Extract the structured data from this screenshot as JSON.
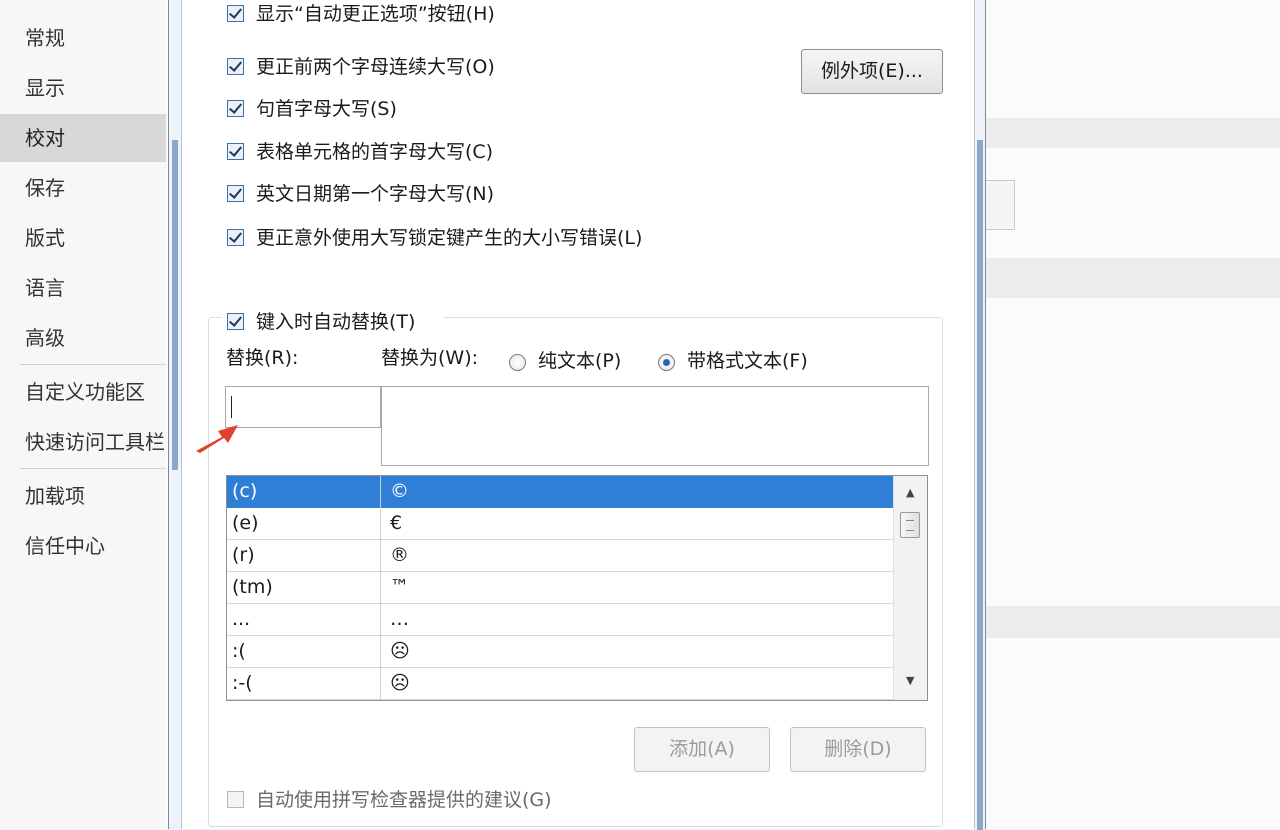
{
  "nav": {
    "items": [
      {
        "label": "常规"
      },
      {
        "label": "显示"
      },
      {
        "label": "校对",
        "selected": true
      },
      {
        "label": "保存"
      },
      {
        "label": "版式"
      },
      {
        "label": "语言"
      },
      {
        "label": "高级"
      },
      {
        "label": "自定义功能区"
      },
      {
        "label": "快速访问工具栏"
      },
      {
        "label": "加载项"
      },
      {
        "label": "信任中心"
      }
    ]
  },
  "autocorrect": {
    "show_options_button": {
      "label": "显示“自动更正选项”按钮(H)",
      "checked": true
    },
    "two_initial_caps": {
      "label": "更正前两个字母连续大写(O)",
      "checked": true
    },
    "capitalize_sentences": {
      "label": "句首字母大写(S)",
      "checked": true
    },
    "capitalize_table_cells": {
      "label": "表格单元格的首字母大写(C)",
      "checked": true
    },
    "capitalize_day_names": {
      "label": "英文日期第一个字母大写(N)",
      "checked": true
    },
    "caps_lock_correction": {
      "label": "更正意外使用大写锁定键产生的大小写错误(L)",
      "checked": true
    },
    "exceptions_button": "例外项(E)...",
    "replace_as_you_type": {
      "label": "键入时自动替换(T)",
      "checked": true
    },
    "replace_label": "替换(R):",
    "with_label": "替换为(W):",
    "plain_text_option": {
      "label": "纯文本(P)",
      "selected": false
    },
    "formatted_text_option": {
      "label": "带格式文本(F)",
      "selected": true
    },
    "replace_value": "",
    "with_value": "",
    "entries": [
      {
        "replace": "(c)",
        "with": "©"
      },
      {
        "replace": "(e)",
        "with": "€"
      },
      {
        "replace": "(r)",
        "with": "®"
      },
      {
        "replace": "(tm)",
        "with": "™"
      },
      {
        "replace": "...",
        "with": "…"
      },
      {
        "replace": ":(",
        "with": "☹"
      },
      {
        "replace": ":-(",
        "with": "☹"
      }
    ],
    "selected_entry": 0,
    "add_button": "添加(A)",
    "delete_button": "删除(D)",
    "spelling_suggestions": {
      "label": "自动使用拼写检查器提供的建议(G)",
      "checked": false
    }
  },
  "colors": {
    "selection": "#2f7fd6",
    "annotation_arrow": "#e0412e"
  },
  "icons": {
    "scroll_up": "▲",
    "scroll_down": "▼",
    "annotation": "red-arrow-icon"
  }
}
